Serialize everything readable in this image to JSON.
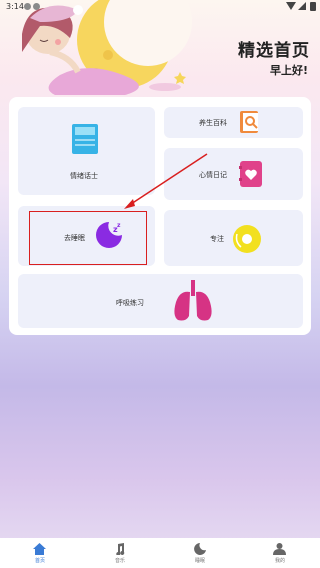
{
  "status": {
    "time": "3:14"
  },
  "header": {
    "title": "精选首页",
    "greeting": "早上好!"
  },
  "cards": {
    "sleep_story": "情绪话士",
    "health": "养生百科",
    "mood_diary": "心情日记",
    "sleep_aid": "去睡眠",
    "focus": "专注",
    "breathing": "呼吸练习"
  },
  "tabs": [
    {
      "label": "首页",
      "icon": "home-icon"
    },
    {
      "label": "音乐",
      "icon": "music-icon"
    },
    {
      "label": "睡眠",
      "icon": "moon-icon"
    },
    {
      "label": "我的",
      "icon": "person-icon"
    }
  ],
  "colors": {
    "accent": "#3a7bd5",
    "highlight": "#d91f1f",
    "moon": "#f6d65a",
    "lungs": "#d63384"
  }
}
